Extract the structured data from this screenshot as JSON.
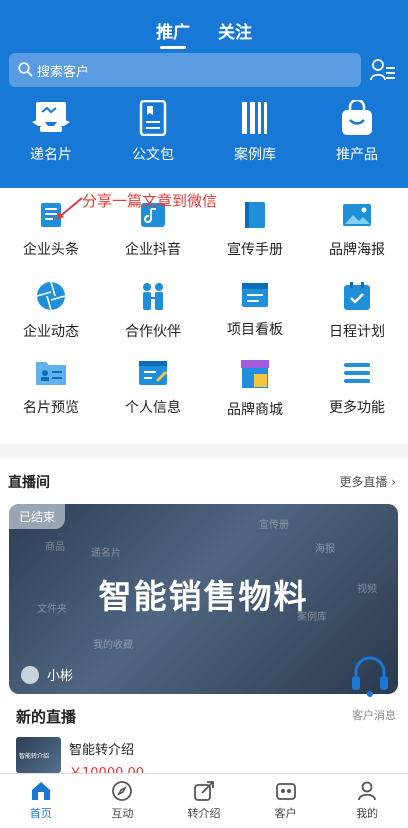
{
  "tabs": [
    "推广",
    "关注"
  ],
  "search": {
    "placeholder": "搜索客户"
  },
  "top_nav": [
    "递名片",
    "公文包",
    "案例库",
    "推产品"
  ],
  "annotation": "分享一篇文章到微信",
  "grid": [
    "企业头条",
    "企业抖音",
    "宣传手册",
    "品牌海报",
    "企业动态",
    "合作伙伴",
    "项目看板",
    "日程计划",
    "名片预览",
    "个人信息",
    "品牌商城",
    "更多功能"
  ],
  "live": {
    "title": "直播间",
    "more": "更多直播",
    "badge": "已结束",
    "banner_title": "智能销售物料",
    "host": "小彬",
    "ghost_labels": [
      "宣传册",
      "递名片",
      "海报",
      "商品",
      "视频",
      "文件夹",
      "案例库",
      "我的收藏"
    ],
    "new_live": "新的直播",
    "customer_msg": "客户消息",
    "product": {
      "thumb_text": "智能转介绍",
      "name": "智能转介绍",
      "price": "￥10000.00"
    }
  },
  "tabbar": [
    "首页",
    "互动",
    "转介绍",
    "客户",
    "我的"
  ],
  "colors": {
    "primary": "#1778d6",
    "accent_red": "#e53935"
  }
}
